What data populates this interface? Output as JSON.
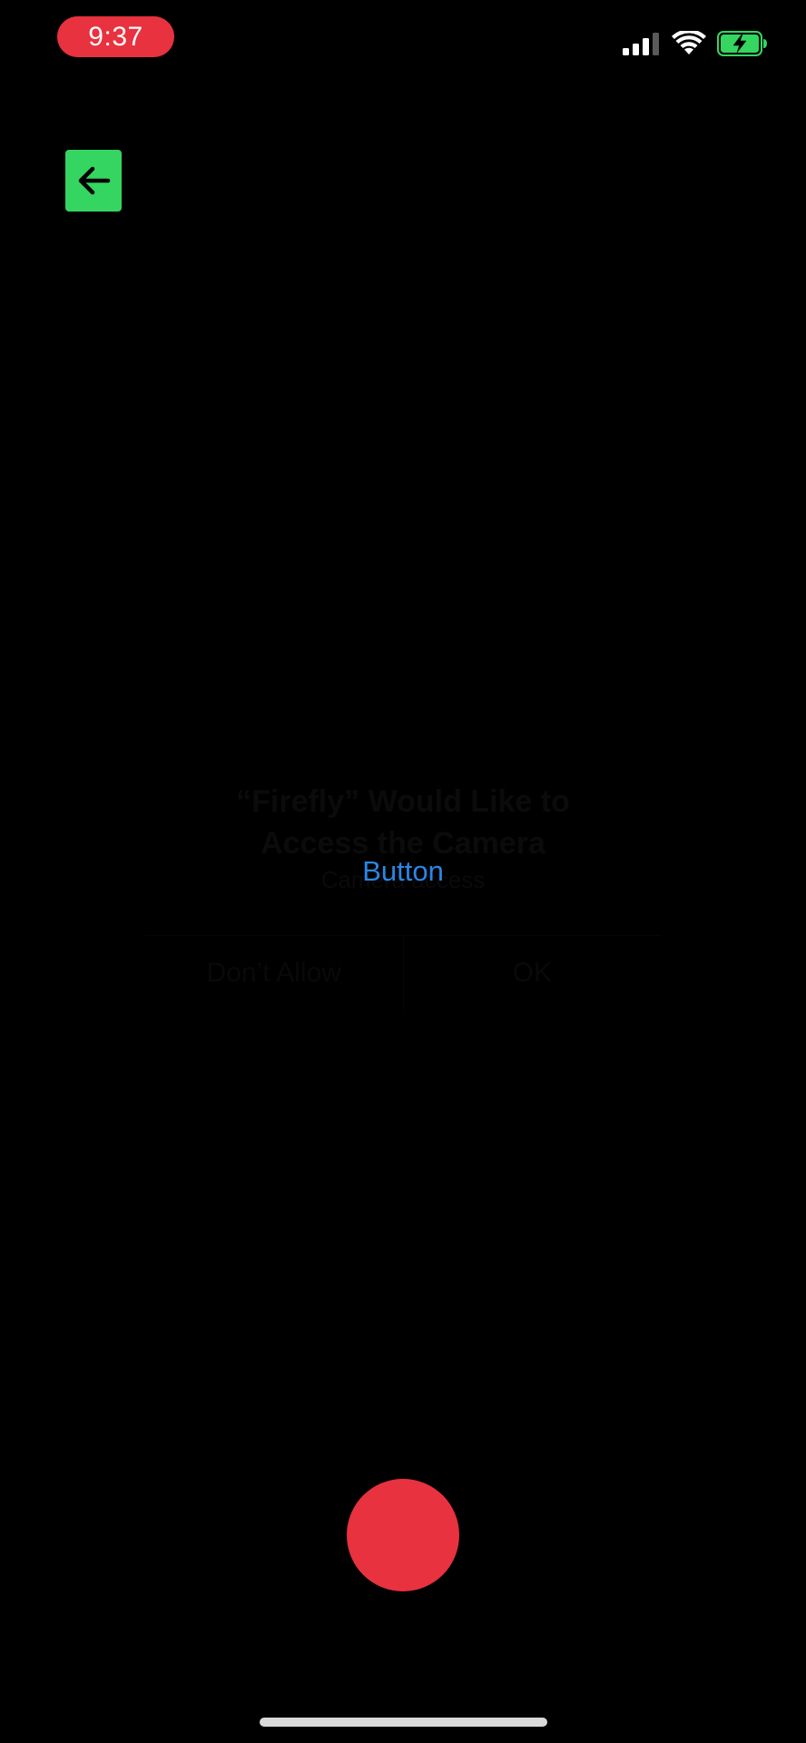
{
  "status_bar": {
    "time": "9:37",
    "time_pill_color": "#e8323f",
    "icons": [
      "signal-icon",
      "wifi-icon",
      "battery-charging-icon"
    ],
    "battery_color": "#35d561"
  },
  "toolbar": {
    "back_icon": "arrow-left-icon",
    "back_button_color": "#35d561"
  },
  "permission_dialog": {
    "title_line1": "“Firefly” Would Like to",
    "title_line2": "Access the Camera",
    "subtitle": "Camera access",
    "deny_label": "Don’t Allow",
    "allow_label": "OK"
  },
  "main": {
    "center_button_label": "Button",
    "link_color": "#2b86e5"
  },
  "controls": {
    "record_button_color": "#e8323f"
  }
}
